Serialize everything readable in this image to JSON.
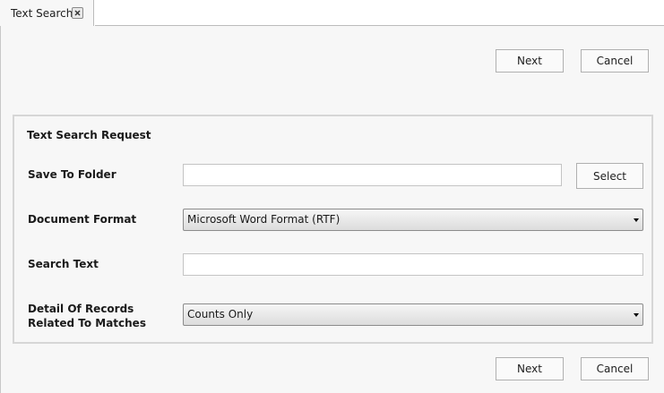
{
  "tab": {
    "label": "Text Search"
  },
  "top_actions": {
    "next_label": "Next",
    "cancel_label": "Cancel"
  },
  "form": {
    "section_title": "Text Search Request",
    "save_to_folder": {
      "label": "Save To Folder",
      "value": "",
      "select_label": "Select"
    },
    "document_format": {
      "label": "Document Format",
      "selected": "Microsoft Word Format (RTF)"
    },
    "search_text": {
      "label": "Search Text",
      "value": ""
    },
    "detail_of_records": {
      "label": "Detail Of Records Related To Matches",
      "selected": "Counts Only"
    }
  },
  "bottom_actions": {
    "next_label": "Next",
    "cancel_label": "Cancel"
  }
}
